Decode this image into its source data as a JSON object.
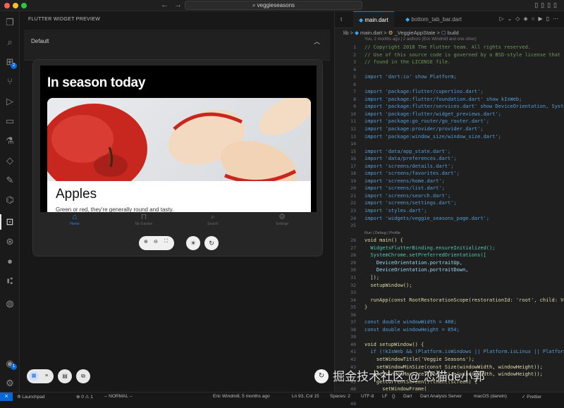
{
  "window": {
    "search_text": "veggieseasons",
    "traffic_lights": [
      "#ff5f57",
      "#febc2e",
      "#28c840"
    ]
  },
  "activity_bar": {
    "badges": {
      "extensions": "2",
      "testing": "1"
    }
  },
  "panel": {
    "title": "FLUTTER WIDGET PREVIEW",
    "section_label": "Default",
    "phone": {
      "heading": "In season today",
      "card_title": "Apples",
      "card_subtitle": "Green or red, they're generally round and tasty."
    },
    "bottom_nav": [
      {
        "label": "Home",
        "icon": "home-icon",
        "active": true
      },
      {
        "label": "My Garden",
        "icon": "book-icon",
        "active": false
      },
      {
        "label": "Search",
        "icon": "search-icon",
        "active": false
      },
      {
        "label": "Settings",
        "icon": "gear-icon",
        "active": false
      }
    ],
    "accent_color": "#1e88ff"
  },
  "editor": {
    "tabs": [
      {
        "label": "t",
        "active": false
      },
      {
        "label": "main.dart",
        "active": true
      },
      {
        "label": "bottom_tab_bar.dart",
        "active": false
      }
    ],
    "breadcrumb": {
      "lib": "lib",
      "file": "main.dart",
      "class": "_VeggieAppState",
      "method": "build"
    },
    "blame": "You, 2 months ago | 2 authors (Eric Windmill and one other)",
    "codelens": "Run | Debug | Profile",
    "line_numbers": [
      "1",
      "2",
      "3",
      "4",
      "5",
      "6",
      "7",
      "8",
      "9",
      "10",
      "11",
      "12",
      "13",
      "14",
      "15",
      "16",
      "17",
      "18",
      "19",
      "20",
      "21",
      "22",
      "23",
      "24",
      "25",
      "",
      "26",
      "27",
      "28",
      "29",
      "30",
      "31",
      "32",
      "33",
      "34",
      "35",
      "36",
      "37",
      "38",
      "39",
      "40",
      "41",
      "42",
      "43",
      "44",
      "45",
      "46",
      "47",
      "48"
    ],
    "code": [
      {
        "cls": "c-com",
        "text": "// Copyright 2018 The Flutter team. All rights reserved."
      },
      {
        "cls": "c-com",
        "text": "// Use of this source code is governed by a BSD-style license that can be"
      },
      {
        "cls": "c-com",
        "text": "// found in the LICENSE file."
      },
      {
        "cls": "c-def",
        "text": ""
      },
      {
        "cls": "c-kw",
        "text": "import 'dart:io' show Platform;"
      },
      {
        "cls": "c-def",
        "text": ""
      },
      {
        "cls": "c-kw",
        "text": "import 'package:flutter/cupertino.dart';"
      },
      {
        "cls": "c-kw",
        "text": "import 'package:flutter/foundation.dart' show kIsWeb;"
      },
      {
        "cls": "c-kw",
        "text": "import 'package:flutter/services.dart' show DeviceOrientation, SystemChrome;"
      },
      {
        "cls": "c-kw",
        "text": "import 'package:flutter/widget_previews.dart';"
      },
      {
        "cls": "c-kw",
        "text": "import 'package:go_router/go_router.dart';"
      },
      {
        "cls": "c-kw",
        "text": "import 'package:provider/provider.dart';"
      },
      {
        "cls": "c-kw",
        "text": "import 'package:window_size/window_size.dart';"
      },
      {
        "cls": "c-def",
        "text": ""
      },
      {
        "cls": "c-kw",
        "text": "import 'data/app_state.dart';"
      },
      {
        "cls": "c-kw",
        "text": "import 'data/preferences.dart';"
      },
      {
        "cls": "c-kw",
        "text": "import 'screens/details.dart';"
      },
      {
        "cls": "c-kw",
        "text": "import 'screens/favorites.dart';"
      },
      {
        "cls": "c-kw",
        "text": "import 'screens/home.dart';"
      },
      {
        "cls": "c-kw",
        "text": "import 'screens/list.dart';"
      },
      {
        "cls": "c-kw",
        "text": "import 'screens/search.dart';"
      },
      {
        "cls": "c-kw",
        "text": "import 'screens/settings.dart';"
      },
      {
        "cls": "c-kw",
        "text": "import 'styles.dart';"
      },
      {
        "cls": "c-kw",
        "text": "import 'widgets/veggie_seasons_page.dart';"
      },
      {
        "cls": "c-def",
        "text": ""
      },
      {
        "cls": "codelens",
        "text": "Run | Debug | Profile"
      },
      {
        "cls": "c-fn",
        "text": "void main() {"
      },
      {
        "cls": "c-typ",
        "text": "  WidgetsFlutterBinding.ensureInitialized();"
      },
      {
        "cls": "c-typ",
        "text": "  SystemChrome.setPreferredOrientations(["
      },
      {
        "cls": "c-var",
        "text": "    DeviceOrientation.portraitUp,"
      },
      {
        "cls": "c-var",
        "text": "    DeviceOrientation.portraitDown,"
      },
      {
        "cls": "c-def",
        "text": "  ]);"
      },
      {
        "cls": "c-fn",
        "text": "  setupWindow();"
      },
      {
        "cls": "c-def",
        "text": ""
      },
      {
        "cls": "c-fn",
        "text": "  runApp(const RootRestorationScope(restorationId: 'root', child: VeggieApp()));"
      },
      {
        "cls": "c-def",
        "text": "}"
      },
      {
        "cls": "c-def",
        "text": ""
      },
      {
        "cls": "c-kw",
        "text": "const double windowWidth = 480;"
      },
      {
        "cls": "c-kw",
        "text": "const double windowHeight = 854;"
      },
      {
        "cls": "c-def",
        "text": ""
      },
      {
        "cls": "c-fn",
        "text": "void setupWindow() {"
      },
      {
        "cls": "c-kw",
        "text": "  if (!kIsWeb && (Platform.isWindows || Platform.isLinux || Platform.isMacOS)) {"
      },
      {
        "cls": "c-fn",
        "text": "    setWindowTitle('Veggie Seasons');"
      },
      {
        "cls": "c-fn",
        "text": "    setWindowMinSize(const Size(windowWidth, windowHeight));"
      },
      {
        "cls": "c-fn",
        "text": "    setWindowMaxSize(const Size(windowWidth, windowHeight));"
      },
      {
        "cls": "c-fn",
        "text": "    getCurrentScreen().then((screen) {"
      },
      {
        "cls": "c-fn",
        "text": "      setWindowFrame("
      }
    ]
  },
  "statusbar": {
    "launchpad": "Launchpad",
    "problems": "⊗ 0 ⚠ 1",
    "mode": "-- NORMAL --",
    "blame": "Eric Windmill, 5 months ago",
    "position": "Ln 93, Col 15",
    "spaces": "Spaces: 2",
    "encoding": "UTF-8",
    "eol": "LF",
    "braces": "{}",
    "language": "Dart",
    "analysis": "Dart Analysis Server",
    "device": "macOS (darwin)",
    "prettier": "✓ Prettier"
  },
  "watermark": "掘金技术社区 @ 恋猫de小郭"
}
